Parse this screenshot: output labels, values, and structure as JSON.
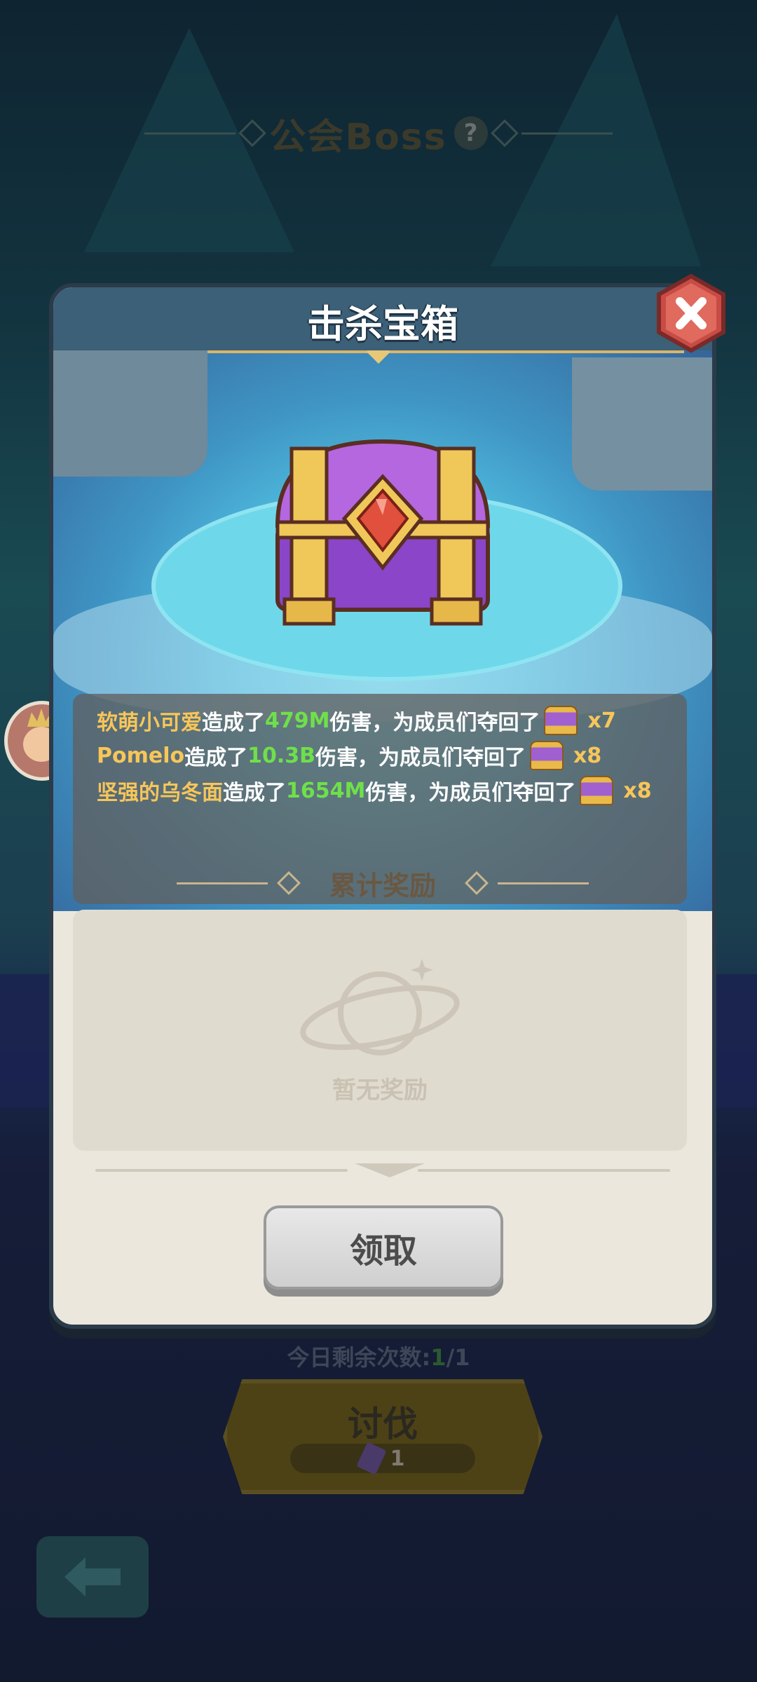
{
  "background": {
    "screen_title": "公会Boss",
    "help_label": "?",
    "remaining_label": "今日剩余次数:",
    "remaining_value": "1",
    "remaining_total": "/1",
    "attack_label": "讨伐",
    "attack_cost": "1"
  },
  "dialog": {
    "title": "击杀宝箱",
    "damage_log": [
      {
        "name": "软萌小可爱",
        "mid1": "造成了",
        "damage": "479M",
        "mid2": "伤害，为成员们夺回了",
        "count": "x7"
      },
      {
        "name": "Pomelo",
        "mid1": "造成了",
        "damage": "10.3B",
        "mid2": "伤害，为成员们夺回了",
        "count": "x8"
      },
      {
        "name": "坚强的乌冬面",
        "mid1": "造成了",
        "damage": "1654M",
        "mid2": "伤害，为成员们夺回了",
        "count": "x8"
      }
    ],
    "rewards_title": "累计奖励",
    "empty_rewards": "暂无奖励",
    "claim_label": "领取"
  },
  "colors": {
    "name": "#f7c659",
    "damage": "#6ee04a",
    "header": "#3b6077",
    "close": "#c94b45"
  },
  "icons": [
    "close-icon",
    "chest-icon",
    "planet-icon",
    "back-arrow-icon",
    "ticket-icon"
  ]
}
